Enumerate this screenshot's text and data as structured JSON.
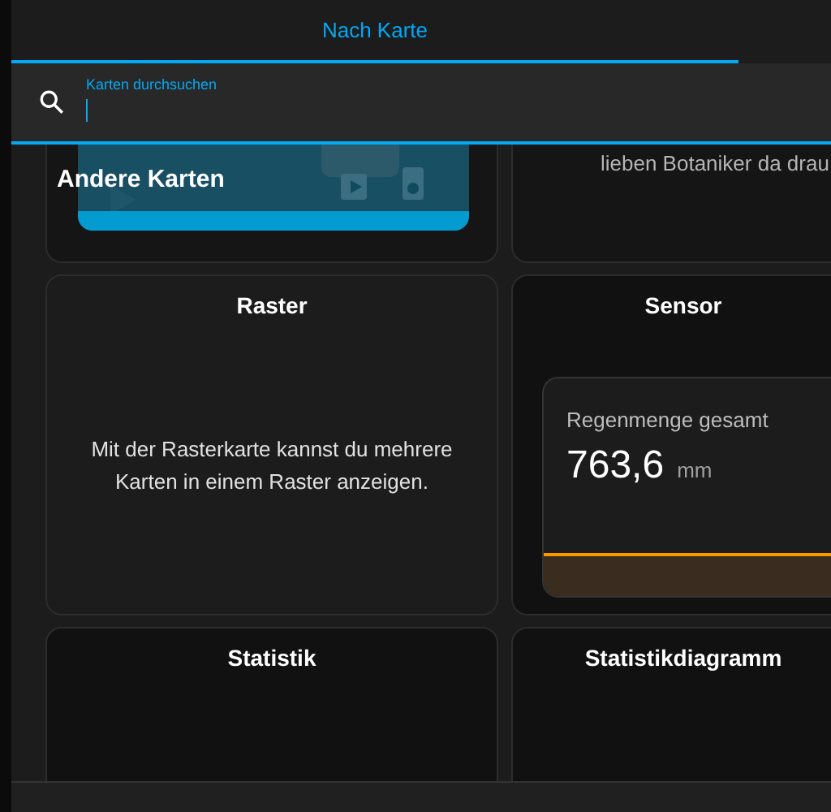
{
  "tabs": [
    {
      "label": "Nach Karte",
      "selected": true
    }
  ],
  "search": {
    "label": "Karten durchsuchen",
    "focused": true
  },
  "cards": [
    {
      "kind": "preview",
      "heading": "Andere Karten"
    },
    {
      "kind": "text",
      "description": "lieben Botaniker da drau"
    },
    {
      "kind": "description",
      "title": "Raster",
      "description": "Mit der Rasterkarte kannst du mehrere Karten in einem Raster anzeigen."
    },
    {
      "kind": "sensor",
      "title": "Sensor",
      "sensor": {
        "name": "Regenmenge gesamt",
        "value": "763,6",
        "unit": "mm"
      }
    },
    {
      "kind": "empty",
      "title": "Statistik"
    },
    {
      "kind": "empty",
      "title": "Statistikdiagramm"
    }
  ]
}
